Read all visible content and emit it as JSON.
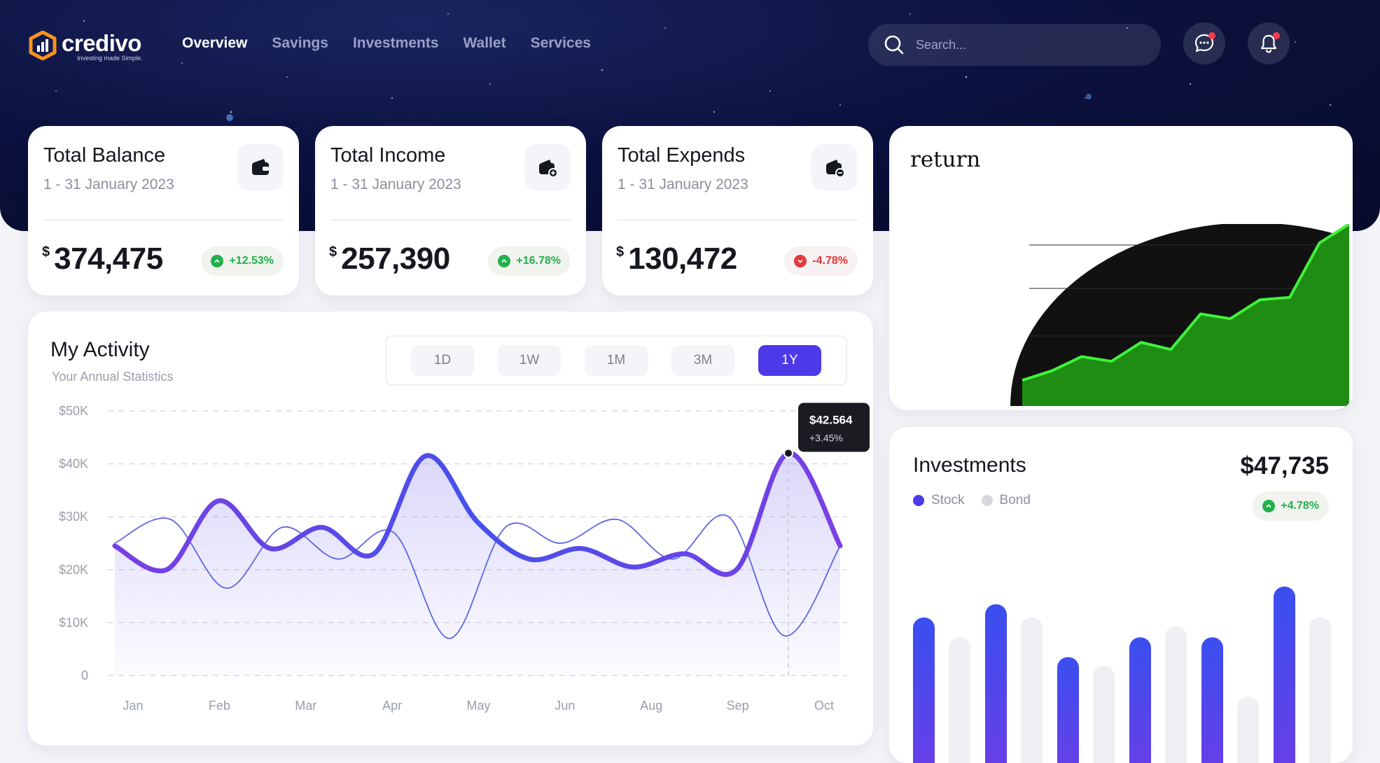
{
  "brand": {
    "name": "credivo",
    "tagline": "Investing made Simple."
  },
  "nav": {
    "items": [
      "Overview",
      "Savings",
      "Investments",
      "Wallet",
      "Services"
    ],
    "active": "Overview"
  },
  "search": {
    "placeholder": "Search..."
  },
  "stats": [
    {
      "title": "Total Balance",
      "period": "1 - 31 January 2023",
      "currency": "$",
      "amount": "374,475",
      "change": "+12.53%",
      "trend": "up",
      "icon": "wallet-icon"
    },
    {
      "title": "Total Income",
      "period": "1 - 31 January 2023",
      "currency": "$",
      "amount": "257,390",
      "change": "+16.78%",
      "trend": "up",
      "icon": "wallet-in-icon"
    },
    {
      "title": "Total Expends",
      "period": "1 - 31 January 2023",
      "currency": "$",
      "amount": "130,472",
      "change": "-4.78%",
      "trend": "down",
      "icon": "wallet-out-icon"
    }
  ],
  "return_panel": {
    "title": "return"
  },
  "activity": {
    "title": "My Activity",
    "subtitle": "Your Annual Statistics",
    "ranges": [
      "1D",
      "1W",
      "1M",
      "3M",
      "1Y"
    ],
    "active_range": "1Y",
    "tooltip": {
      "value": "$42.564",
      "change": "+3.45%"
    }
  },
  "investments": {
    "title": "Investments",
    "total": "$47,735",
    "change": "+4.78%",
    "legend": [
      {
        "name": "Stock",
        "color": "#4c39e8"
      },
      {
        "name": "Bond",
        "color": "#d6d8de"
      }
    ]
  },
  "colors": {
    "accent": "#4c39e8",
    "positive": "#22b14c",
    "negative": "#e5383b",
    "header_bg": "#0c1240"
  },
  "chart_data": [
    {
      "type": "line",
      "ylim": [
        0,
        50
      ],
      "yticks": [
        "$50K",
        "$40K",
        "$30K",
        "$20K",
        "$10K",
        "0"
      ],
      "x": [
        "Jan",
        "Feb",
        "Mar",
        "Apr",
        "May",
        "Jun",
        "Aug",
        "Sep",
        "Oct"
      ],
      "series": [
        {
          "values": [
            24.5,
            20,
            33,
            24,
            28,
            23,
            41.5,
            29,
            22,
            24,
            20.5,
            23,
            20,
            42,
            24.5
          ]
        },
        {
          "values": [
            25,
            29.5,
            16.5,
            28,
            22,
            27,
            7,
            28,
            25,
            29.5,
            22,
            30,
            7.5,
            24.5
          ]
        }
      ],
      "grid": true
    },
    {
      "type": "bar",
      "series": [
        {
          "name": "Stock",
          "values": [
            66,
            72,
            48,
            57,
            57,
            80
          ]
        },
        {
          "name": "Bond",
          "values": [
            57,
            66,
            44,
            62,
            30,
            66
          ]
        }
      ]
    },
    {
      "type": "area",
      "values": [
        2,
        6,
        12,
        10,
        18,
        15,
        30,
        28,
        36,
        37,
        60,
        68
      ]
    }
  ]
}
